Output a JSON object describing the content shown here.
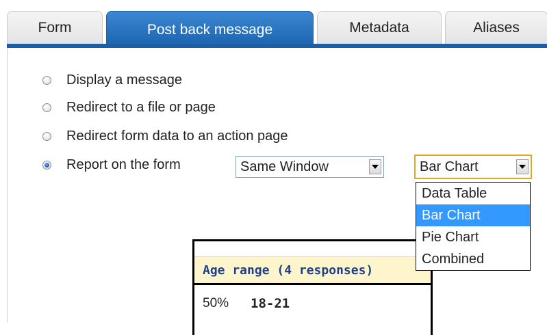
{
  "tabs": [
    {
      "label": "Form",
      "active": false
    },
    {
      "label": "Post back message",
      "active": true
    },
    {
      "label": "Metadata",
      "active": false
    },
    {
      "label": "Aliases",
      "active": false
    }
  ],
  "options": [
    {
      "label": "Display a message",
      "checked": false
    },
    {
      "label": "Redirect to a file or page",
      "checked": false
    },
    {
      "label": "Redirect form data to an action page",
      "checked": false
    },
    {
      "label": "Report on the form",
      "checked": true
    }
  ],
  "window_select": {
    "value": "Same Window"
  },
  "chart_select": {
    "value": "Bar Chart",
    "open": true,
    "options": [
      "Data Table",
      "Bar Chart",
      "Pie Chart",
      "Combined"
    ],
    "selected_index": 1
  },
  "report": {
    "header": "Age range (4 responses)",
    "rows": [
      {
        "percent": "50%",
        "range": "18-21"
      }
    ]
  },
  "colors": {
    "tab_active": "#1a62ad",
    "selection": "#3399ff",
    "report_header_bg": "#fff5cc",
    "report_header_text": "#1f3f8a",
    "focus_border": "#e4a820"
  }
}
